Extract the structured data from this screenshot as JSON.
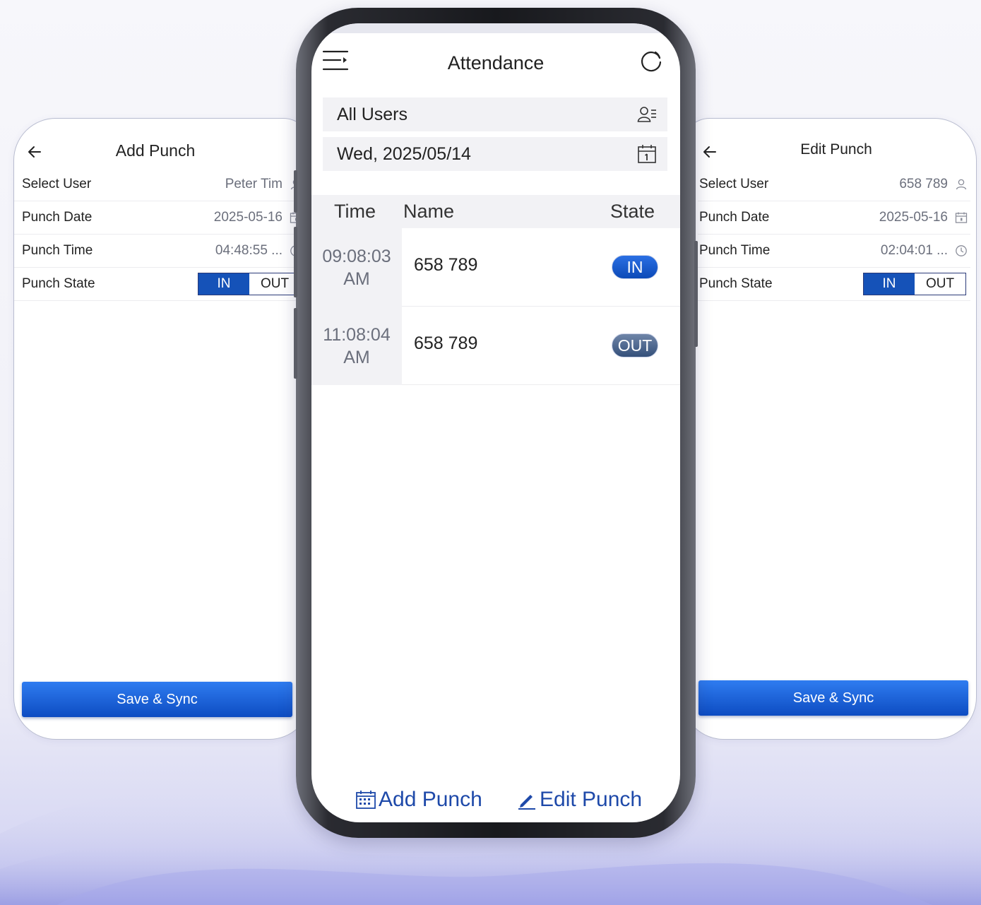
{
  "colors": {
    "accent": "#1552b8",
    "title_text": "#222222",
    "muted_text": "#6b6f7c",
    "bottom_action": "#1e49a9"
  },
  "add_punch": {
    "title": "Add Punch",
    "back_icon": "arrow-left-icon",
    "fields": [
      {
        "label": "Select User",
        "value": "Peter Tim",
        "icon": "user-icon"
      },
      {
        "label": "Punch Date",
        "value": "2025-05-16",
        "icon": "calendar-icon"
      },
      {
        "label": "Punch Time",
        "value": "04:48:55 ...",
        "icon": "clock-icon"
      }
    ],
    "state_label": "Punch State",
    "state_options": [
      "IN",
      "OUT"
    ],
    "state_selected": "IN",
    "save_label": "Save & Sync"
  },
  "attendance": {
    "title": "Attendance",
    "menu_icon": "menu-icon",
    "refresh_icon": "refresh-icon",
    "users_filter": "All Users",
    "users_filter_icon": "user-list-icon",
    "date_filter": "Wed, 2025/05/14",
    "date_filter_icon": "calendar-icon",
    "columns": [
      "Time",
      "Name",
      "State"
    ],
    "rows": [
      {
        "time_line1": "09:08:03",
        "time_line2": "AM",
        "name": "658 789",
        "state": "IN"
      },
      {
        "time_line1": "11:08:04",
        "time_line2": "AM",
        "name": "658 789",
        "state": "OUT"
      }
    ],
    "add_punch_label": "Add Punch",
    "add_punch_icon": "calendar-add-icon",
    "edit_punch_label": "Edit Punch",
    "edit_punch_icon": "pencil-icon"
  },
  "edit_punch": {
    "title": "Edit Punch",
    "back_icon": "arrow-left-icon",
    "fields": [
      {
        "label": "Select User",
        "value": "658 789",
        "icon": "user-icon"
      },
      {
        "label": "Punch Date",
        "value": "2025-05-16",
        "icon": "calendar-icon"
      },
      {
        "label": "Punch Time",
        "value": "02:04:01 ...",
        "icon": "clock-icon"
      }
    ],
    "state_label": "Punch State",
    "state_options": [
      "IN",
      "OUT"
    ],
    "state_selected": "IN",
    "save_label": "Save & Sync"
  }
}
